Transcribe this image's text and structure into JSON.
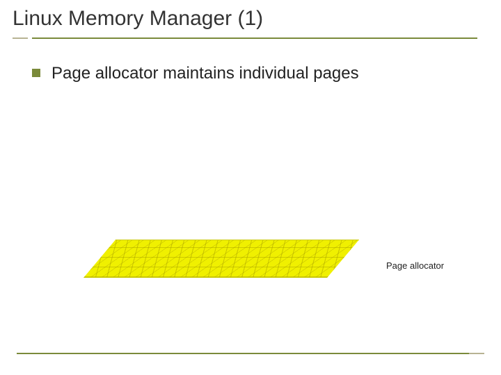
{
  "title": "Linux Memory Manager (1)",
  "bullets": [
    {
      "text": "Page allocator maintains individual pages"
    }
  ],
  "graphic": {
    "label": "Page allocator"
  },
  "colors": {
    "accent": "#7a8a3a",
    "bullet": "#7a8a3a",
    "graphic_fill": "#f0f000"
  }
}
